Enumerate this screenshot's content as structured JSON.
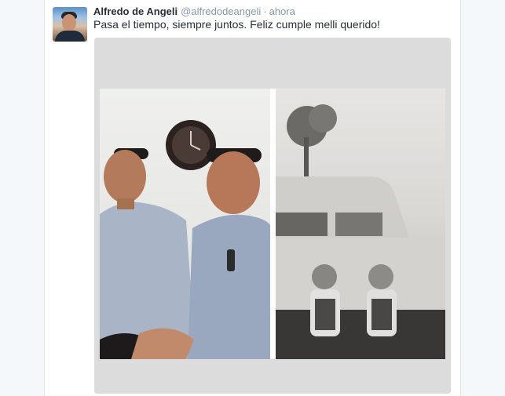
{
  "tweet": {
    "author_name": "Alfredo de Angeli",
    "author_handle": "@alfredodeangeli",
    "separator": "·",
    "timestamp": "ahora",
    "text": "Pasa el tiempo, siempre juntos. Feliz cumple melli querido!"
  },
  "colors": {
    "page_background": "#f5f8fa",
    "name_text": "#292f33",
    "meta_text": "#8899a6"
  }
}
